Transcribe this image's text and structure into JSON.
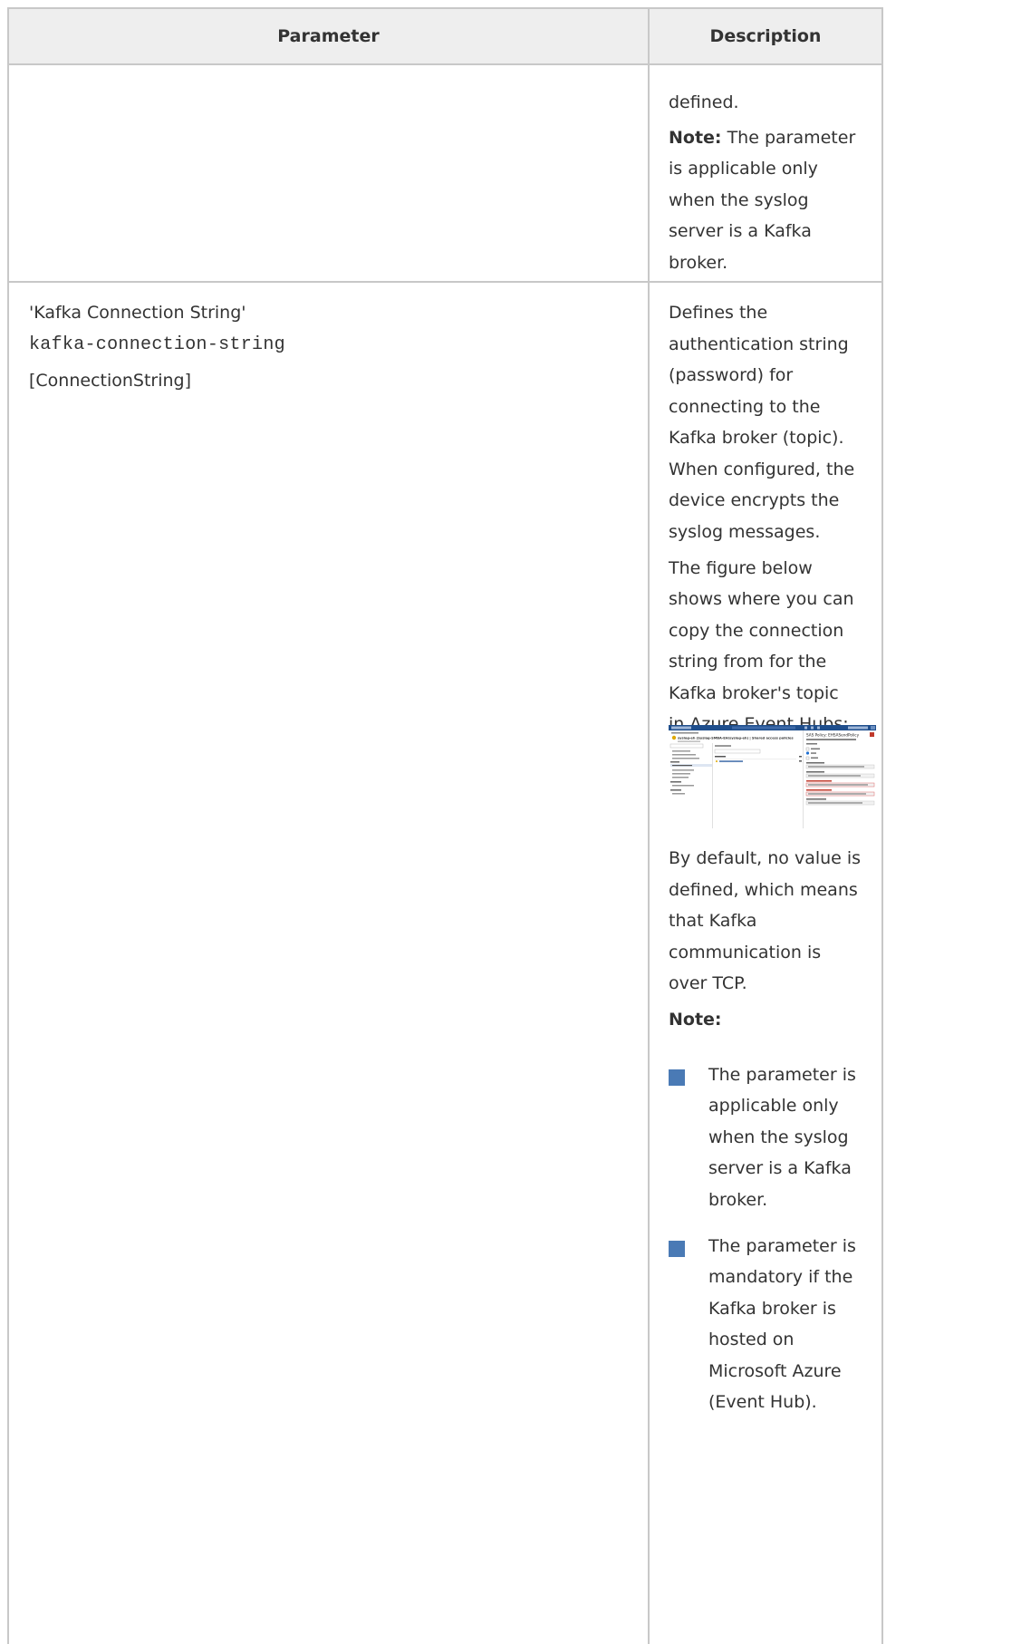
{
  "header": {
    "parameter": "Parameter",
    "description": "Description"
  },
  "row1": {
    "desc_lines": [
      "defined."
    ],
    "note_label": "Note:",
    "note_first": " The parameter",
    "note_lines": [
      "is applicable only",
      "when the syslog",
      "server is a Kafka",
      "broker."
    ]
  },
  "row2": {
    "param_name": "'Kafka Connection String'",
    "param_cli": "kafka-connection-string",
    "param_ini": "[ConnectionString]",
    "desc_lines": [
      "Defines the",
      "authentication string",
      "(password) for",
      "connecting to the",
      "Kafka broker (topic).",
      "When configured, the",
      "device encrypts the",
      "syslog messages.",
      "The figure below",
      "shows where you can",
      "copy the connection",
      "string from for the",
      "Kafka broker's topic",
      "in Azure Event Hubs:"
    ],
    "figure": {
      "breadcrumb": "syslog-eh (Syslog-SMBA-EH/syslog-eh) | Shared access policies",
      "panel_title": "SAS Policy: EHSASendPolicy"
    },
    "default_lines": [
      "By default, no value is",
      "defined, which means",
      "that Kafka",
      "communication is",
      "over TCP."
    ],
    "note_label": "Note:",
    "bullet1_lines": [
      "The parameter is",
      "applicable only",
      "when the syslog",
      "server is a Kafka",
      "broker."
    ],
    "bullet2_lines": [
      "The parameter is",
      "mandatory if the",
      "Kafka broker is",
      "hosted on",
      "Microsoft Azure",
      "(Event Hub)."
    ]
  },
  "colors": {
    "border": "#c8c8c8",
    "header_bg": "#eeeeee",
    "text": "#333333",
    "bullet": "#4a7ab5"
  }
}
